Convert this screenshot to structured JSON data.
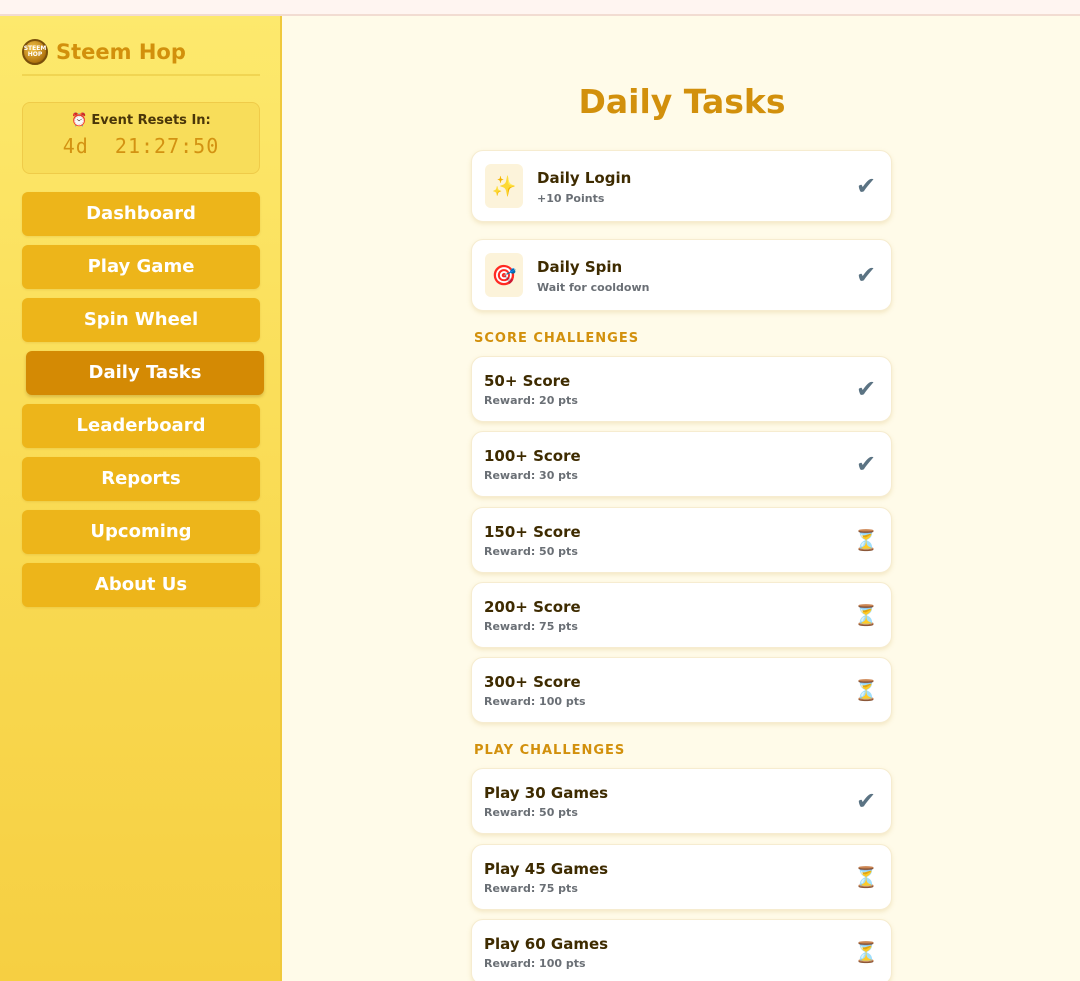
{
  "brand": {
    "name": "Steem Hop",
    "logo_text": "STEEM HOP"
  },
  "reset": {
    "icon": "⏰",
    "label": "Event Resets In:",
    "time": "4d  21:27:50"
  },
  "nav": [
    {
      "label": "Dashboard"
    },
    {
      "label": "Play Game"
    },
    {
      "label": "Spin Wheel"
    },
    {
      "label": "Daily Tasks",
      "active": true
    },
    {
      "label": "Leaderboard"
    },
    {
      "label": "Reports"
    },
    {
      "label": "Upcoming"
    },
    {
      "label": "About Us"
    }
  ],
  "page_title": "Daily Tasks",
  "daily": [
    {
      "icon": "✨",
      "title": "Daily Login",
      "sub": "+10 Points",
      "status": "done"
    },
    {
      "icon": "🎯",
      "title": "Daily Spin",
      "sub": "Wait for cooldown",
      "status": "done"
    }
  ],
  "score_section": "SCORE CHALLENGES",
  "score": [
    {
      "title": "50+ Score",
      "sub": "Reward: 20 pts",
      "status": "done"
    },
    {
      "title": "100+ Score",
      "sub": "Reward: 30 pts",
      "status": "done"
    },
    {
      "title": "150+ Score",
      "sub": "Reward: 50 pts",
      "status": "pending"
    },
    {
      "title": "200+ Score",
      "sub": "Reward: 75 pts",
      "status": "pending"
    },
    {
      "title": "300+ Score",
      "sub": "Reward: 100 pts",
      "status": "pending"
    }
  ],
  "play_section": "PLAY CHALLENGES",
  "play": [
    {
      "title": "Play 30 Games",
      "sub": "Reward: 50 pts",
      "status": "done"
    },
    {
      "title": "Play 45 Games",
      "sub": "Reward: 75 pts",
      "status": "pending"
    },
    {
      "title": "Play 60 Games",
      "sub": "Reward: 100 pts",
      "status": "pending"
    }
  ],
  "icons": {
    "done": "✔",
    "pending": "⏳"
  },
  "colors": {
    "accent": "#d2900c",
    "nav": "#edb51a",
    "nav_active": "#d48a04",
    "bg": "#fffbe9"
  }
}
